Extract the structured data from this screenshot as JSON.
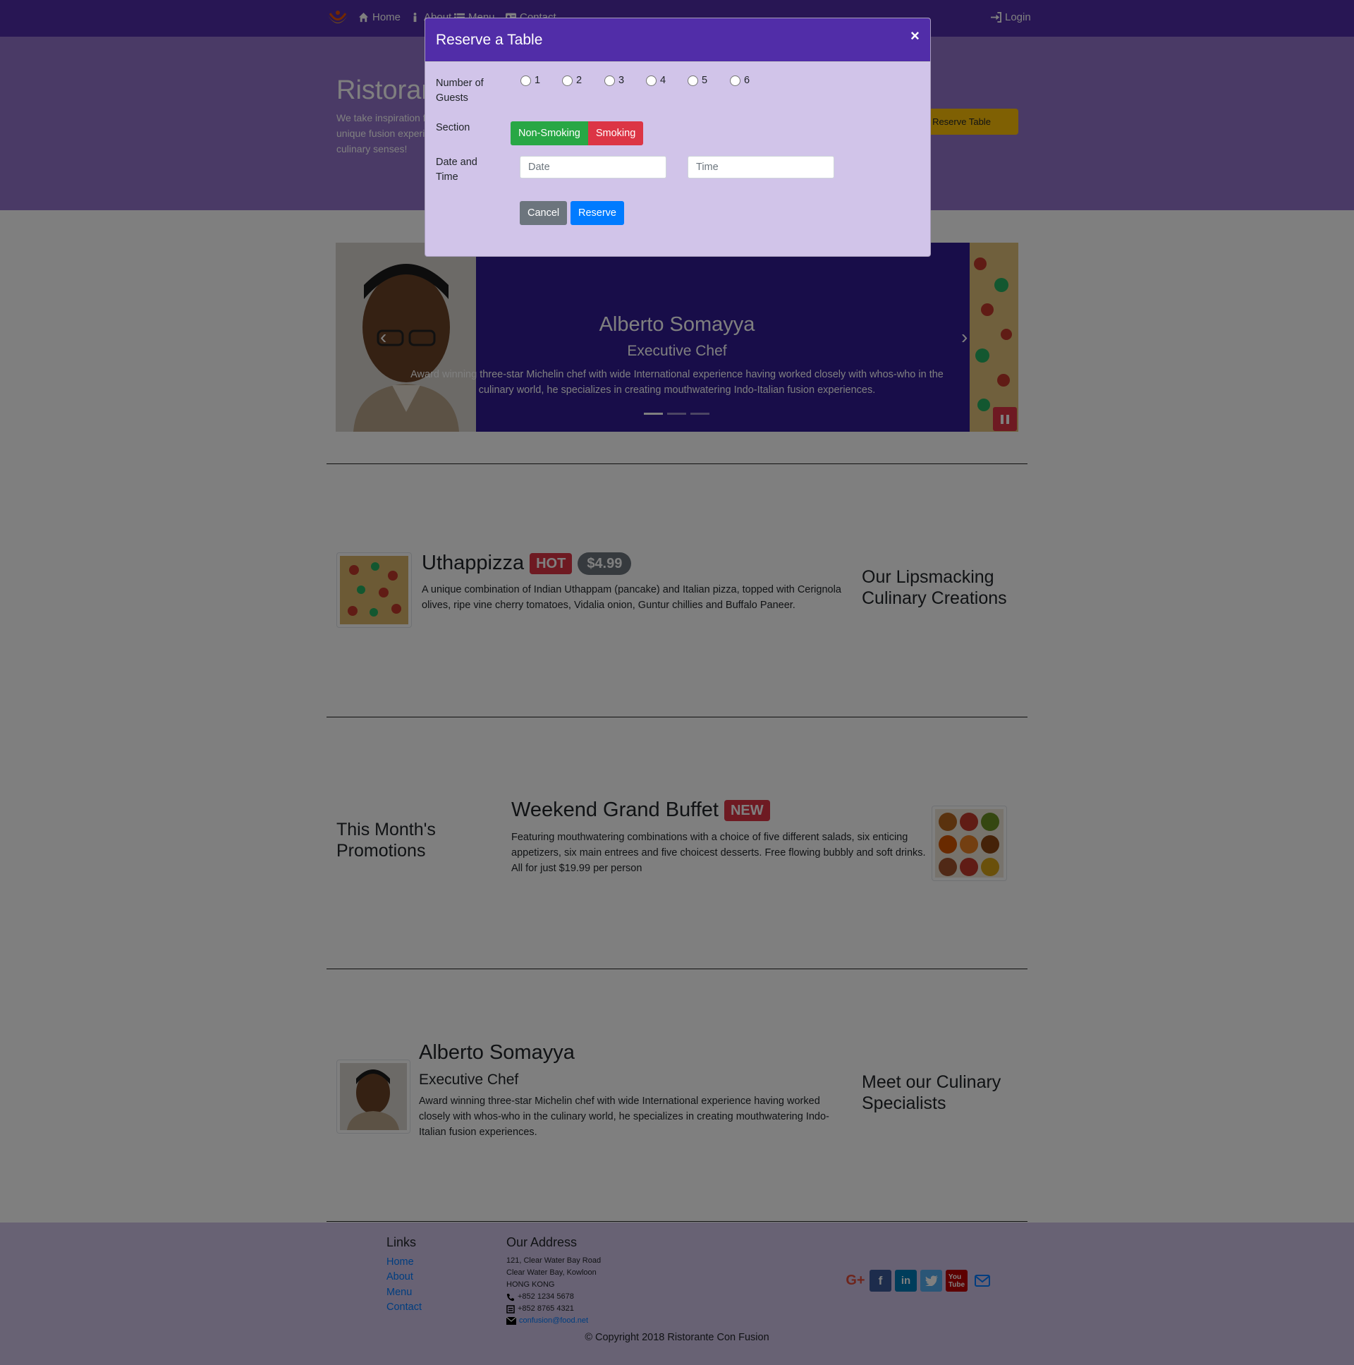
{
  "navbar": {
    "items": [
      {
        "label": "Home",
        "icon": "home-icon"
      },
      {
        "label": "About",
        "icon": "info-icon"
      },
      {
        "label": "Menu",
        "icon": "list-icon"
      },
      {
        "label": "Contact",
        "icon": "address-card-icon"
      }
    ],
    "login": "Login"
  },
  "jumbotron": {
    "title": "Ristorante con Fusion",
    "text": "We take inspiration from the World's best cuisines, and create a unique fusion experience. Our lipsmacking creations will tickle your culinary senses!",
    "reserve_button": "Reserve Table"
  },
  "carousel": {
    "name": "Alberto Somayya",
    "role": "Executive Chef",
    "description": "Award winning three-star Michelin chef with wide International experience having worked closely with whos-who in the culinary world, he specializes in creating mouthwatering Indo-Italian fusion experiences."
  },
  "dishes": {
    "title": "Uthappizza",
    "badge": "HOT",
    "price": "$4.99",
    "description": "A unique combination of Indian Uthappam (pancake) and Italian pizza, topped with Cerignola olives, ripe vine cherry tomatoes, Vidalia onion, Guntur chillies and Buffalo Paneer.",
    "side_heading": "Our Lipsmacking Culinary Creations"
  },
  "promotion": {
    "side_heading": "This Month's Promotions",
    "title": "Weekend Grand Buffet",
    "badge": "NEW",
    "description": "Featuring mouthwatering combinations with a choice of five different salads, six enticing appetizers, six main entrees and five choicest desserts. Free flowing bubbly and soft drinks. All for just $19.99 per person"
  },
  "leader": {
    "name": "Alberto Somayya",
    "role": "Executive Chef",
    "description": "Award winning three-star Michelin chef with wide International experience having worked closely with whos-who in the culinary world, he specializes in creating mouthwatering Indo-Italian fusion experiences.",
    "side_heading": "Meet our Culinary Specialists"
  },
  "footer": {
    "links_heading": "Links",
    "links": [
      "Home",
      "About",
      "Menu",
      "Contact"
    ],
    "address_heading": "Our Address",
    "address": [
      "121, Clear Water Bay Road",
      "Clear Water Bay, Kowloon",
      "HONG KONG"
    ],
    "phone": "+852 1234 5678",
    "fax": "+852 8765 4321",
    "email": "confusion@food.net",
    "copyright": "© Copyright 2018 Ristorante Con Fusion",
    "social_icons": [
      "google-plus-icon",
      "facebook-icon",
      "linkedin-icon",
      "twitter-icon",
      "youtube-icon",
      "envelope-icon"
    ]
  },
  "modal": {
    "title": "Reserve a Table",
    "close": "×",
    "guests_label": "Number of Guests",
    "guest_options": [
      "1",
      "2",
      "3",
      "4",
      "5",
      "6"
    ],
    "section_label": "Section",
    "section_options": [
      "Non-Smoking",
      "Smoking"
    ],
    "datetime_label": "Date and Time",
    "date_placeholder": "Date",
    "time_placeholder": "Time",
    "cancel": "Cancel",
    "reserve": "Reserve"
  },
  "colors": {
    "primary": "#512DA8",
    "light": "#D1C4E9",
    "jumbotron": "#9575CD",
    "carousel": "#311B92",
    "warning": "#FFC107",
    "danger": "#dc3545",
    "success": "#28a745",
    "link": "#007bff"
  }
}
